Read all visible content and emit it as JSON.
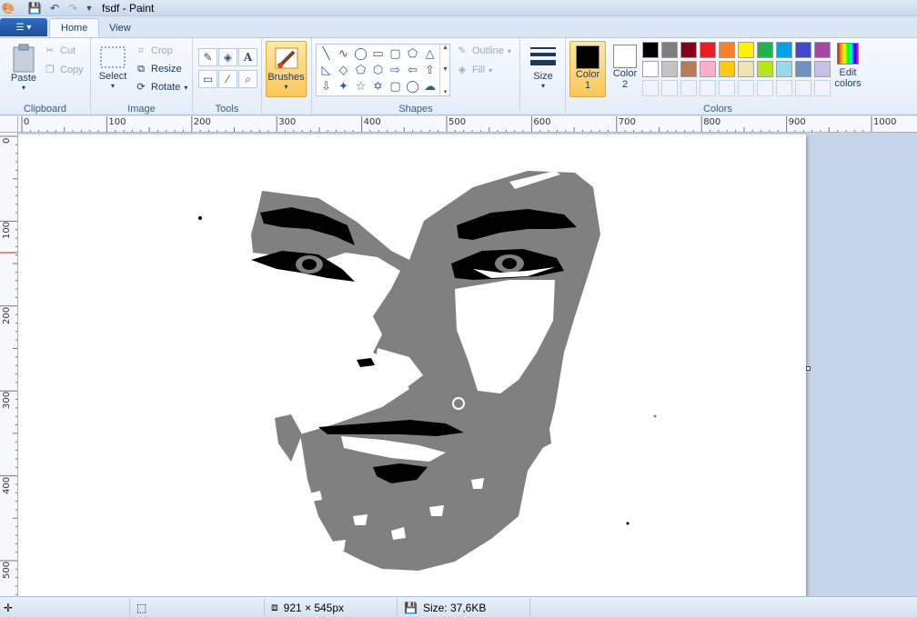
{
  "window": {
    "title": "fsdf - Paint"
  },
  "tabs": [
    {
      "label": "Home"
    },
    {
      "label": "View"
    }
  ],
  "ribbon": {
    "clipboard": {
      "label": "Clipboard",
      "paste": "Paste",
      "cut": "Cut",
      "copy": "Copy"
    },
    "image": {
      "label": "Image",
      "select": "Select",
      "crop": "Crop",
      "resize": "Resize",
      "rotate": "Rotate"
    },
    "tools": {
      "label": "Tools"
    },
    "brushes": {
      "label": "Brushes"
    },
    "shapes": {
      "label": "Shapes",
      "outline": "Outline",
      "fill": "Fill"
    },
    "size": {
      "label": "Size"
    },
    "colors": {
      "label": "Colors",
      "color1_line1": "Color",
      "color1_line2": "1",
      "color2_line1": "Color",
      "color2_line2": "2",
      "color1_value": "#000000",
      "color2_value": "#ffffff",
      "edit_line1": "Edit",
      "edit_line2": "colors",
      "palette_row1": [
        "#000000",
        "#7f7f7f",
        "#880015",
        "#ed1c24",
        "#ff7f27",
        "#fff200",
        "#22b14c",
        "#00a2e8",
        "#3f48cc",
        "#a349a4"
      ],
      "palette_row2": [
        "#ffffff",
        "#c3c3c3",
        "#b97a57",
        "#ffaec9",
        "#ffc90e",
        "#efe4b0",
        "#b5e61d",
        "#99d9ea",
        "#7092be",
        "#c8bfe7"
      ]
    }
  },
  "ruler": {
    "top": [
      "0",
      "100",
      "200",
      "300",
      "400",
      "500",
      "600",
      "700",
      "800",
      "900",
      "1000"
    ],
    "left": [
      "0",
      "100",
      "200",
      "300",
      "400",
      "500"
    ]
  },
  "status": {
    "dimensions": "921 × 545px",
    "size": "Size: 37,6KB"
  }
}
